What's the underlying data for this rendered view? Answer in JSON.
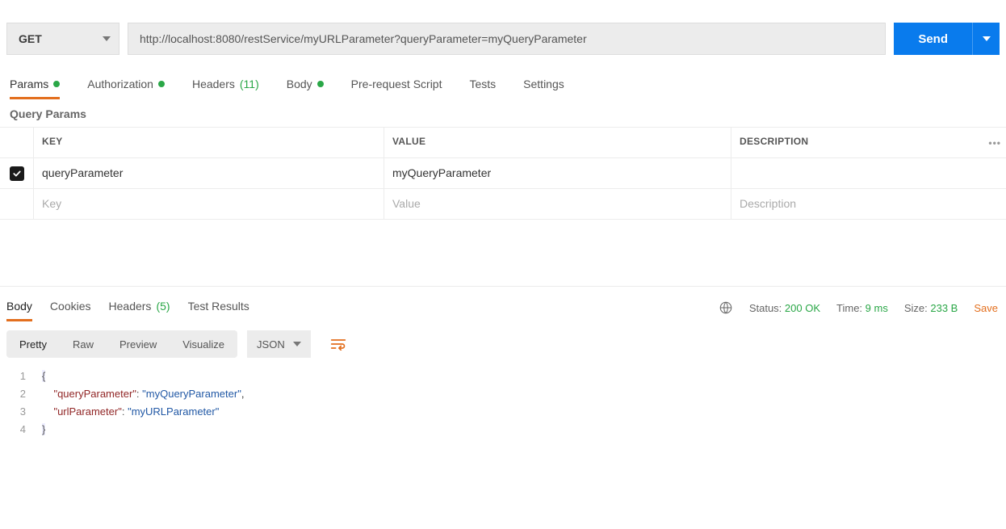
{
  "request": {
    "method": "GET",
    "url": "http://localhost:8080/restService/myURLParameter?queryParameter=myQueryParameter",
    "send_label": "Send"
  },
  "req_tabs": {
    "params": "Params",
    "authorization": "Authorization",
    "headers": "Headers",
    "headers_count": "(11)",
    "body": "Body",
    "prerequest": "Pre-request Script",
    "tests": "Tests",
    "settings": "Settings"
  },
  "query_params": {
    "section_label": "Query Params",
    "header_key": "KEY",
    "header_value": "VALUE",
    "header_desc": "DESCRIPTION",
    "rows": [
      {
        "checked": true,
        "key": "queryParameter",
        "value": "myQueryParameter",
        "desc": ""
      }
    ],
    "placeholder_key": "Key",
    "placeholder_value": "Value",
    "placeholder_desc": "Description"
  },
  "resp_tabs": {
    "body": "Body",
    "cookies": "Cookies",
    "headers": "Headers",
    "headers_count": "(5)",
    "test_results": "Test Results"
  },
  "resp_meta": {
    "status_label": "Status:",
    "status_value": "200 OK",
    "time_label": "Time:",
    "time_value": "9 ms",
    "size_label": "Size:",
    "size_value": "233 B",
    "save": "Save"
  },
  "fmt": {
    "pretty": "Pretty",
    "raw": "Raw",
    "preview": "Preview",
    "visualize": "Visualize",
    "lang": "JSON"
  },
  "response_body": {
    "line1": "{",
    "line2_key": "\"queryParameter\"",
    "line2_val": "\"myQueryParameter\"",
    "line3_key": "\"urlParameter\"",
    "line3_val": "\"myURLParameter\"",
    "line4": "}"
  }
}
